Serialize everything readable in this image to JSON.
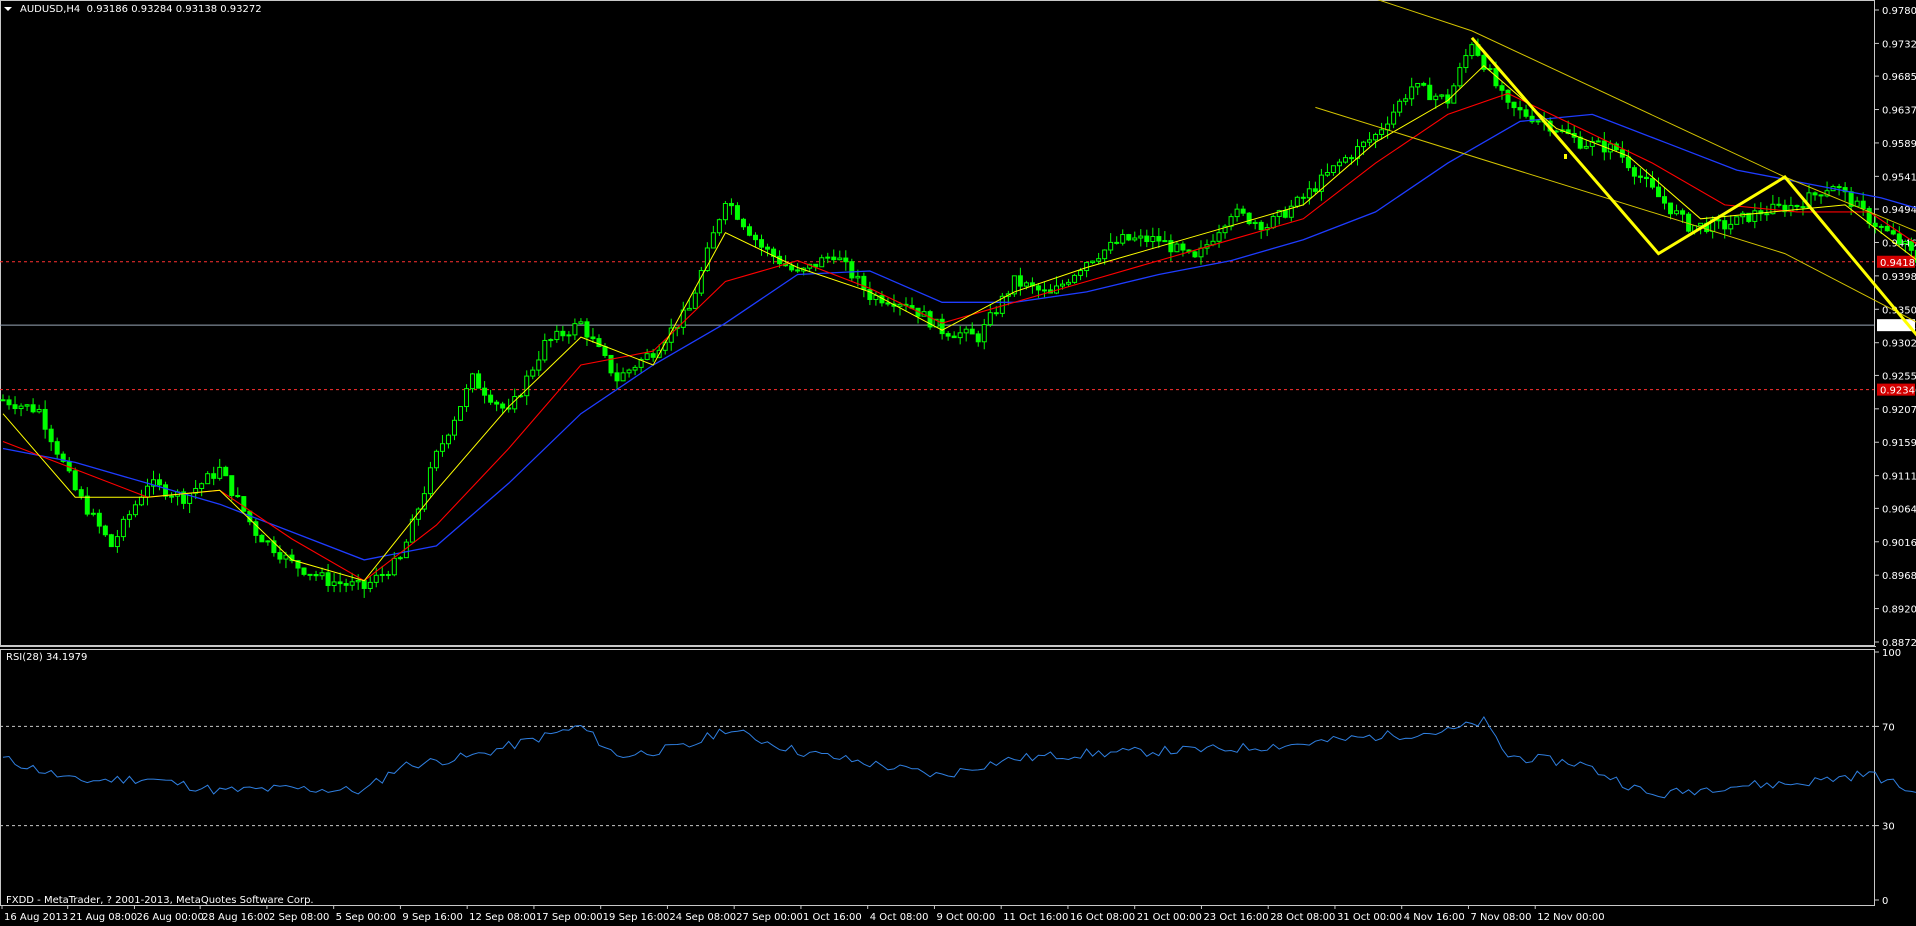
{
  "header": {
    "symbol_label": "AUDUSD,H4",
    "ohlc_values": "0.93186 0.93284 0.93138 0.93272",
    "rsi_label": "RSI(28) 34.1979",
    "copyright": "FXDD - MetaTrader, ? 2001-2013, MetaQuotes Software Corp."
  },
  "chart_data": [
    {
      "type": "candlestick",
      "symbol": "AUDUSD",
      "timeframe": "H4",
      "ohlc": {
        "open": 0.93186,
        "high": 0.93284,
        "low": 0.93138,
        "close": 0.93272
      },
      "ylim": [
        0.8872,
        0.978
      ],
      "y_ticks": [
        "0.97800",
        "0.97320",
        "0.96850",
        "0.96370",
        "0.95890",
        "0.95410",
        "0.94940",
        "0.94460",
        "0.93980",
        "0.93500",
        "0.93020",
        "0.92550",
        "0.92070",
        "0.91590",
        "0.91110",
        "0.90640",
        "0.90160",
        "0.89680",
        "0.89200",
        "0.88720"
      ],
      "x_ticks": [
        "16 Aug 2013",
        "21 Aug 08:00",
        "26 Aug 00:00",
        "28 Aug 16:00",
        "2 Sep 08:00",
        "5 Sep 00:00",
        "9 Sep 16:00",
        "12 Sep 08:00",
        "17 Sep 00:00",
        "19 Sep 16:00",
        "24 Sep 08:00",
        "27 Sep 00:00",
        "1 Oct 16:00",
        "4 Oct 08:00",
        "9 Oct 00:00",
        "11 Oct 16:00",
        "16 Oct 08:00",
        "21 Oct 00:00",
        "23 Oct 16:00",
        "28 Oct 08:00",
        "31 Oct 00:00",
        "4 Nov 16:00",
        "7 Nov 08:00",
        "12 Nov 00:00"
      ],
      "current_price_label": "0.93272",
      "resistance_label": "0.94183",
      "support_label": "0.92346",
      "series_colors": {
        "candle": "#00ff00",
        "ma_fast": "#ffff00",
        "ma_mid": "#ff0000",
        "ma_slow": "#1e3cff",
        "channel": "#d4c400",
        "pattern": "#ffff00",
        "level_lines": "#ff3030",
        "price_line": "#9aa8b8"
      },
      "price_path": [
        [
          0,
          0.922
        ],
        [
          6,
          0.9205
        ],
        [
          12,
          0.909
        ],
        [
          18,
          0.901
        ],
        [
          24,
          0.91
        ],
        [
          30,
          0.908
        ],
        [
          36,
          0.912
        ],
        [
          42,
          0.903
        ],
        [
          48,
          0.8985
        ],
        [
          54,
          0.896
        ],
        [
          60,
          0.895
        ],
        [
          66,
          0.899
        ],
        [
          72,
          0.914
        ],
        [
          78,
          0.925
        ],
        [
          84,
          0.92
        ],
        [
          90,
          0.93
        ],
        [
          96,
          0.933
        ],
        [
          102,
          0.925
        ],
        [
          108,
          0.929
        ],
        [
          114,
          0.935
        ],
        [
          120,
          0.951
        ],
        [
          126,
          0.944
        ],
        [
          132,
          0.94
        ],
        [
          138,
          0.943
        ],
        [
          144,
          0.937
        ],
        [
          150,
          0.936
        ],
        [
          156,
          0.932
        ],
        [
          162,
          0.931
        ],
        [
          168,
          0.939
        ],
        [
          174,
          0.937
        ],
        [
          180,
          0.942
        ],
        [
          186,
          0.945
        ],
        [
          192,
          0.945
        ],
        [
          198,
          0.942
        ],
        [
          204,
          0.949
        ],
        [
          210,
          0.947
        ],
        [
          216,
          0.951
        ],
        [
          222,
          0.956
        ],
        [
          228,
          0.96
        ],
        [
          234,
          0.967
        ],
        [
          240,
          0.965
        ],
        [
          244,
          0.9735
        ],
        [
          250,
          0.964
        ],
        [
          256,
          0.962
        ],
        [
          262,
          0.959
        ],
        [
          268,
          0.958
        ],
        [
          274,
          0.952
        ],
        [
          280,
          0.947
        ],
        [
          286,
          0.947
        ],
        [
          292,
          0.949
        ],
        [
          298,
          0.95
        ],
        [
          304,
          0.953
        ],
        [
          310,
          0.948
        ],
        [
          316,
          0.944
        ],
        [
          322,
          0.938
        ],
        [
          328,
          0.935
        ],
        [
          334,
          0.932
        ]
      ],
      "ma_fast": [
        [
          0,
          0.92
        ],
        [
          12,
          0.908
        ],
        [
          24,
          0.908
        ],
        [
          36,
          0.909
        ],
        [
          48,
          0.899
        ],
        [
          60,
          0.896
        ],
        [
          72,
          0.909
        ],
        [
          84,
          0.921
        ],
        [
          96,
          0.931
        ],
        [
          108,
          0.927
        ],
        [
          120,
          0.946
        ],
        [
          132,
          0.941
        ],
        [
          144,
          0.9375
        ],
        [
          156,
          0.932
        ],
        [
          168,
          0.9375
        ],
        [
          180,
          0.941
        ],
        [
          192,
          0.944
        ],
        [
          204,
          0.947
        ],
        [
          216,
          0.95
        ],
        [
          228,
          0.959
        ],
        [
          240,
          0.965
        ],
        [
          246,
          0.97
        ],
        [
          258,
          0.961
        ],
        [
          270,
          0.957
        ],
        [
          282,
          0.948
        ],
        [
          294,
          0.949
        ],
        [
          306,
          0.95
        ],
        [
          318,
          0.942
        ],
        [
          330,
          0.933
        ]
      ],
      "ma_mid": [
        [
          0,
          0.916
        ],
        [
          12,
          0.912
        ],
        [
          24,
          0.908
        ],
        [
          36,
          0.909
        ],
        [
          48,
          0.902
        ],
        [
          60,
          0.896
        ],
        [
          72,
          0.904
        ],
        [
          84,
          0.915
        ],
        [
          96,
          0.927
        ],
        [
          108,
          0.929
        ],
        [
          120,
          0.939
        ],
        [
          132,
          0.942
        ],
        [
          144,
          0.938
        ],
        [
          156,
          0.933
        ],
        [
          168,
          0.936
        ],
        [
          180,
          0.939
        ],
        [
          192,
          0.942
        ],
        [
          204,
          0.945
        ],
        [
          216,
          0.948
        ],
        [
          228,
          0.956
        ],
        [
          240,
          0.963
        ],
        [
          250,
          0.966
        ],
        [
          262,
          0.961
        ],
        [
          274,
          0.956
        ],
        [
          286,
          0.95
        ],
        [
          298,
          0.949
        ],
        [
          310,
          0.949
        ],
        [
          322,
          0.942
        ],
        [
          336,
          0.935
        ]
      ],
      "ma_slow": [
        [
          0,
          0.915
        ],
        [
          12,
          0.913
        ],
        [
          24,
          0.91
        ],
        [
          36,
          0.907
        ],
        [
          48,
          0.903
        ],
        [
          60,
          0.899
        ],
        [
          72,
          0.901
        ],
        [
          84,
          0.91
        ],
        [
          96,
          0.92
        ],
        [
          108,
          0.927
        ],
        [
          120,
          0.933
        ],
        [
          132,
          0.94
        ],
        [
          144,
          0.9405
        ],
        [
          156,
          0.936
        ],
        [
          168,
          0.936
        ],
        [
          180,
          0.9375
        ],
        [
          192,
          0.94
        ],
        [
          204,
          0.942
        ],
        [
          216,
          0.945
        ],
        [
          228,
          0.949
        ],
        [
          240,
          0.956
        ],
        [
          252,
          0.962
        ],
        [
          264,
          0.963
        ],
        [
          276,
          0.959
        ],
        [
          288,
          0.955
        ],
        [
          300,
          0.953
        ],
        [
          312,
          0.951
        ],
        [
          324,
          0.948
        ],
        [
          334,
          0.944
        ]
      ],
      "channel_upper": [
        [
          150,
          1.002
        ],
        [
          244,
          0.975
        ],
        [
          296,
          0.954
        ],
        [
          408,
          0.914
        ]
      ],
      "channel_lower": [
        [
          218,
          0.964
        ],
        [
          296,
          0.943
        ],
        [
          336,
          0.925
        ],
        [
          408,
          0.892
        ]
      ],
      "pattern": [
        [
          244,
          0.974
        ],
        [
          275,
          0.943
        ],
        [
          296,
          0.954
        ],
        [
          323,
          0.926
        ],
        [
          345,
          0.94
        ]
      ]
    },
    {
      "type": "line",
      "name": "RSI(28)",
      "value": 34.1979,
      "ylim": [
        0,
        100
      ],
      "y_ticks": [
        "100",
        "70",
        "30",
        "0"
      ],
      "levels": [
        70,
        30
      ],
      "points": [
        [
          0,
          57
        ],
        [
          12,
          48
        ],
        [
          24,
          49
        ],
        [
          36,
          44
        ],
        [
          48,
          45
        ],
        [
          60,
          44
        ],
        [
          66,
          54
        ],
        [
          78,
          58
        ],
        [
          90,
          66
        ],
        [
          96,
          70
        ],
        [
          102,
          58
        ],
        [
          114,
          62
        ],
        [
          120,
          69
        ],
        [
          132,
          60
        ],
        [
          144,
          55
        ],
        [
          156,
          50
        ],
        [
          162,
          54
        ],
        [
          168,
          57
        ],
        [
          180,
          59
        ],
        [
          192,
          60
        ],
        [
          204,
          61
        ],
        [
          216,
          63
        ],
        [
          228,
          66
        ],
        [
          240,
          68
        ],
        [
          246,
          72
        ],
        [
          250,
          58
        ],
        [
          262,
          55
        ],
        [
          274,
          42
        ],
        [
          286,
          46
        ],
        [
          298,
          47
        ],
        [
          310,
          51
        ],
        [
          316,
          45
        ],
        [
          322,
          38
        ],
        [
          330,
          34
        ],
        [
          334,
          34
        ]
      ],
      "arrow": [
        [
          330,
          33
        ],
        [
          350,
          48
        ]
      ],
      "ellipse": [
        336,
        30
      ]
    }
  ]
}
